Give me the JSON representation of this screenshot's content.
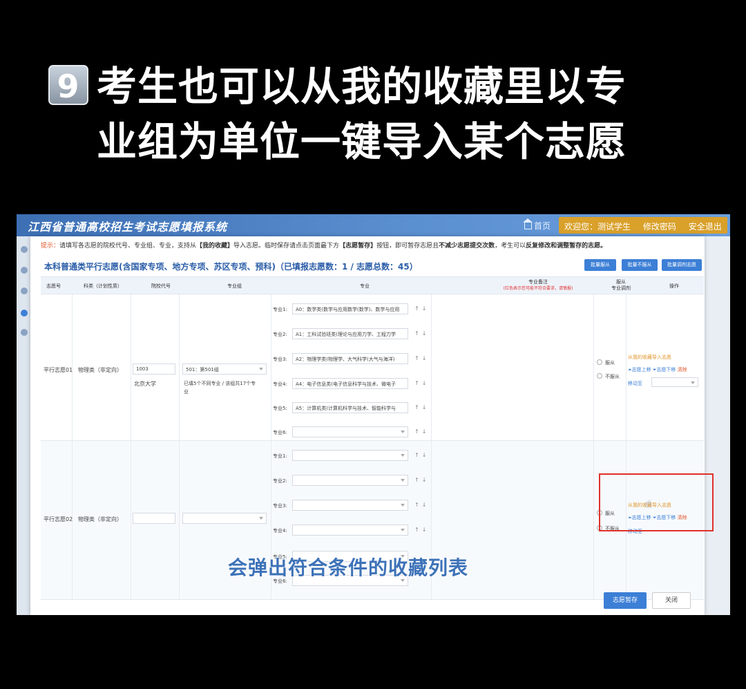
{
  "caption": {
    "number": "9",
    "line1": "考生也可以从我的收藏里以专",
    "line2": "业组为单位一键导入某个志愿"
  },
  "subtitle": "会弹出符合条件的收藏列表",
  "topbar": {
    "system_title": "江西省普通高校招生考试志愿填报系统",
    "home": "首页",
    "welcome": "欢迎您：测试学生",
    "change_password": "修改密码",
    "logout": "安全退出"
  },
  "tip": {
    "prefix": "提示：",
    "text1": "请填写各志愿的院校代号、专业组、专业，支持从",
    "bold1": "【我的收藏】",
    "text2": "导入志愿。临时保存请点击页面最下方",
    "bold2": "【志愿暂存】",
    "text3": "按钮，即可暂存志愿且",
    "bold3": "不减少志愿提交次数",
    "text4": "，考生可以",
    "bold4": "反复修改和调整暂存的志愿。"
  },
  "section_title": "本科普通类平行志愿(含国家专项、地方专项、苏区专项、预科)（已填报志愿数：1 / 志愿总数：45）",
  "bulk_buttons": [
    "批量服从",
    "批量不服从",
    "批量调剂志愿"
  ],
  "columns": {
    "zhiyuan_no": "志愿号",
    "category": "科类（计划性质）",
    "school_code": "院校代号",
    "major_group": "专业组",
    "major": "专业",
    "note": "专业备注",
    "note_red": "(红色表示您可能不符合要求，请慎报)",
    "obey_1": "服从",
    "obey_2": "专业调剂",
    "action": "操作"
  },
  "rows": [
    {
      "zhiyuan": "平行志愿01",
      "category": "物理类（非定向）",
      "school_code": "1003",
      "school_name": "北京大学",
      "group": "501：第501组",
      "group_note_1": "已填5个不同专业 / 该组共17个专",
      "group_note_2": "业",
      "majors": [
        {
          "label": "专业1:",
          "value": "A0：数学类(数学与应用数学(数学)、数学与应用"
        },
        {
          "label": "专业2:",
          "value": "A1：工科试验班类(理论与应用力学、工程力学"
        },
        {
          "label": "专业3:",
          "value": "A2：物理学类(物理学、大气科学(大气与海洋)"
        },
        {
          "label": "专业4:",
          "value": "A4：电子信息类(电子信息科学与技术、微电子"
        },
        {
          "label": "专业5:",
          "value": "A5：计算机类(计算机科学与技术、智能科学与"
        },
        {
          "label": "专业6:",
          "value": ""
        }
      ],
      "obey": "服从",
      "not_obey": "不服从",
      "import": "从我的收藏导入志愿",
      "move_up": "志愿上移",
      "move_down": "志愿下移",
      "clear": "清除",
      "move_to": "移动至"
    },
    {
      "zhiyuan": "平行志愿02",
      "category": "物理类（非定向）",
      "majors": [
        {
          "label": "专业1:"
        },
        {
          "label": "专业2:"
        },
        {
          "label": "专业3:"
        },
        {
          "label": "专业4:"
        },
        {
          "label": "专业5:"
        },
        {
          "label": "专业6:"
        }
      ],
      "obey": "服从",
      "not_obey": "不服从",
      "import": "从我的收藏导入志愿",
      "move_up": "志愿上移",
      "move_down": "志愿下移",
      "clear": "清除",
      "move_to": "移动至"
    }
  ],
  "footer": {
    "save": "志愿暂存",
    "close": "关闭"
  },
  "colors": {
    "topbar": "#4a7fc4",
    "accent": "#3c7fd6",
    "highlight": "#e0302a",
    "welcome_bg": "#d9a02a"
  }
}
